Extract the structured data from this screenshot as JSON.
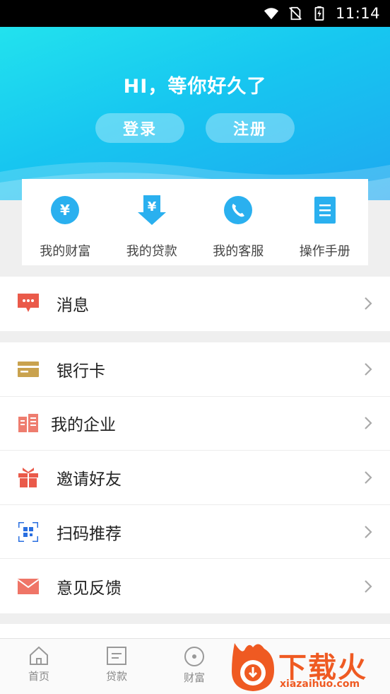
{
  "status_bar": {
    "time": "11:14",
    "icons": [
      "wifi-icon",
      "no-sim-icon",
      "battery-charging-icon"
    ]
  },
  "hero": {
    "greeting": "HI，等你好久了",
    "login_label": "登录",
    "register_label": "注册"
  },
  "quick_actions": [
    {
      "label": "我的财富",
      "icon": "yen-coin-icon"
    },
    {
      "label": "我的贷款",
      "icon": "yen-download-icon"
    },
    {
      "label": "我的客服",
      "icon": "phone-icon"
    },
    {
      "label": "操作手册",
      "icon": "document-icon"
    }
  ],
  "menu_group_1": [
    {
      "label": "消息",
      "icon": "message-icon"
    }
  ],
  "menu_group_2": [
    {
      "label": "银行卡",
      "icon": "bank-card-icon"
    },
    {
      "label": "我的企业",
      "icon": "building-icon"
    },
    {
      "label": "邀请好友",
      "icon": "gift-icon"
    },
    {
      "label": "扫码推荐",
      "icon": "qr-scan-icon"
    },
    {
      "label": "意见反馈",
      "icon": "mail-icon"
    }
  ],
  "tab_bar": [
    {
      "label": "首页",
      "icon": "home-icon"
    },
    {
      "label": "贷款",
      "icon": "loan-icon"
    },
    {
      "label": "财富",
      "icon": "wealth-icon"
    }
  ],
  "watermark": {
    "text": "下载火",
    "url": "xiazaihuo.com"
  },
  "colors": {
    "hero_start": "#22e2ee",
    "hero_end": "#1ea8f0",
    "accent_blue": "#1aa8f0",
    "watermark": "#ef5a22"
  }
}
